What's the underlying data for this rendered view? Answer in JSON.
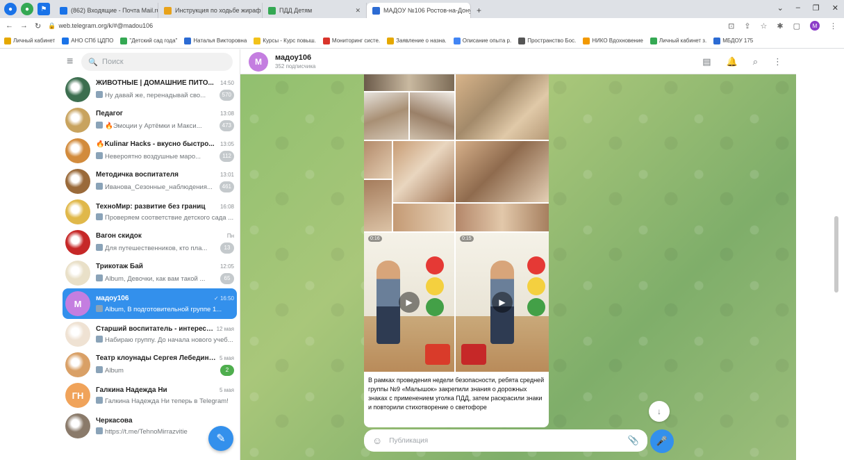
{
  "browser": {
    "tabs": [
      {
        "label": "(862) Входящие - Почта Mail.ru",
        "color": "#1a73e8"
      },
      {
        "label": "Инструкция по ходьбе жираф",
        "color": "#e8a21a"
      },
      {
        "label": "ПДД Детям",
        "color": "#34a853"
      },
      {
        "label": "МАДОУ №106 Ростов-на-Дону",
        "color": "#2c6bd3",
        "active": true
      }
    ],
    "new_tab": "+",
    "url": "web.telegram.org/k/#@madou106",
    "bookmarks": [
      "Личный кабинет",
      "АНО СПб ЦДПО",
      "\"Детский сад года\"",
      "Наталья Викторовна",
      "Курсы - Курс повыш.",
      "Мониторинг систе.",
      "Заявление о назна.",
      "Описание опыта р.",
      "Пространство Бос.",
      "НИКО Вдохновение",
      "Личный кабинет з.",
      "МБДОУ 175"
    ],
    "profile_initial": "M"
  },
  "sidebar": {
    "search_placeholder": "Поиск",
    "chats": [
      {
        "name": "ЖИВОТНЫЕ | ДОМАШНИЕ ПИТО...",
        "time": "14:50",
        "message": "Ну давай же, перенадывай сво...",
        "badge": "570",
        "avatar_color": "#3c6e4f",
        "initial": ""
      },
      {
        "name": "Педагог",
        "time": "13:08",
        "message": "🔥Эмоции у Артёмки и Макси...",
        "badge": "473",
        "avatar_color": "#c8a35e",
        "initial": ""
      },
      {
        "name": "🔥Kulinar Hacks - вкусно быстро...",
        "time": "13:05",
        "message": "Невероятно воздушные маро...",
        "badge": "112",
        "avatar_color": "#d28b3c",
        "initial": ""
      },
      {
        "name": "Методичка воспитателя",
        "time": "13:01",
        "message": "Иванова_Сезонные_наблюдения...",
        "badge": "461",
        "avatar_color": "#9a6a3a",
        "initial": ""
      },
      {
        "name": "ТехноМир: развитие без границ",
        "time": "16:08",
        "message": "Проверяем соответствие детского сада ...",
        "badge": "",
        "avatar_color": "#e0b84a",
        "initial": ""
      },
      {
        "name": "Вагон скидок",
        "time": "Пн",
        "message": "Для путешественников, кто пла...",
        "badge": "13",
        "avatar_color": "#c62828",
        "initial": ""
      },
      {
        "name": "Трикотаж Бай",
        "time": "12:05",
        "message": "Album, Девочки, как вам такой ...",
        "badge": "65",
        "avatar_color": "#e9e0c8",
        "initial": ""
      },
      {
        "name": "мадоу106",
        "time": "✓ 16:50",
        "message": "Album, В подготовительной группе 1...",
        "badge": "",
        "avatar_color": "#c47ee0",
        "initial": "M",
        "active": true
      },
      {
        "name": "Старший воспитатель - интересно...",
        "time": "12 мая",
        "message": "Набираю группу. До начала нового учеб...",
        "badge": "",
        "avatar_color": "#efe2d3",
        "initial": ""
      },
      {
        "name": "Театр клоунады Сергея Лебединск...",
        "time": "5 мая",
        "message": "Album",
        "badge": "2",
        "badge_green": true,
        "avatar_color": "#d9a066",
        "initial": ""
      },
      {
        "name": "Галкина Надежда Ни",
        "time": "5 мая",
        "message": "Галкина Надежда Ни теперь в Telegram!",
        "badge": "",
        "avatar_color": "#f0a35a",
        "initial": "ГН"
      },
      {
        "name": "Черкасова",
        "time": "",
        "message": "https://t.me/TehnoMirrazvitie",
        "badge": "",
        "avatar_color": "#8a7a6a",
        "initial": ""
      }
    ]
  },
  "channel": {
    "title": "мадоу106",
    "subscribers": "352 подписчика",
    "initial": "M",
    "video1_duration": "0:16",
    "video2_duration": "0:15",
    "caption": "В рамках проведения недели безопасности, ребята средней группы №9 «Малышок» закрепили знания о дорожных знаках с применением уголка ПДД, затем раскрасили знаки и повторили стихотворение о светофоре",
    "composer_placeholder": "Публикация"
  }
}
